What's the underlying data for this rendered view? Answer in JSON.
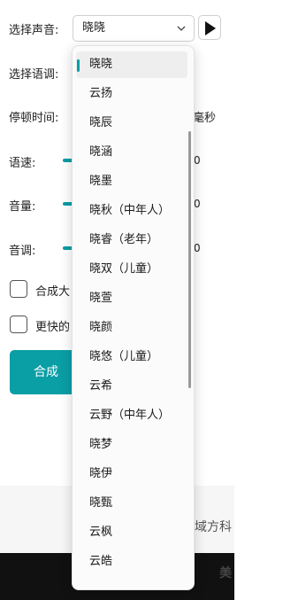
{
  "form": {
    "voice_label": "选择声音:",
    "voice_value": "晓晓",
    "style_label": "选择语调:",
    "pause_label": "停顿时间:",
    "pause_unit": "毫秒",
    "speed_label": "语速:",
    "speed_tail": "0",
    "volume_label": "音量:",
    "volume_tail": "0",
    "pitch_label": "音调:",
    "pitch_tail": "0",
    "option1_label": "合成大",
    "option2_label": "更快的",
    "synthesize_button": "合成"
  },
  "footer": {
    "band_text": "域方科",
    "dark_text": "美"
  },
  "voice_dropdown": {
    "options": [
      "晓晓",
      "云扬",
      "晓辰",
      "晓涵",
      "晓墨",
      "晓秋（中年人）",
      "晓睿（老年）",
      "晓双（儿童）",
      "晓萱",
      "晓颜",
      "晓悠（儿童）",
      "云希",
      "云野（中年人）",
      "晓梦",
      "晓伊",
      "晓甄",
      "云枫",
      "云皓"
    ],
    "selected_index": 0
  },
  "colors": {
    "accent": "#0a9ea5"
  }
}
